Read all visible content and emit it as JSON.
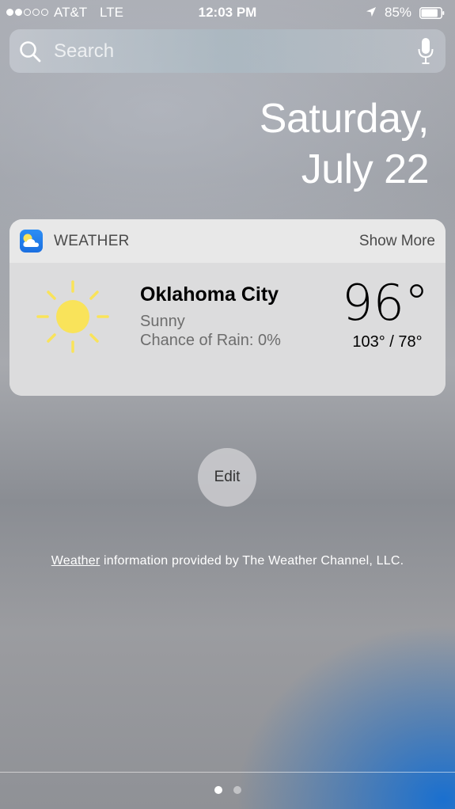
{
  "status_bar": {
    "carrier": "AT&T",
    "network": "LTE",
    "time": "12:03 PM",
    "battery": "85%",
    "battery_level": 0.85,
    "signal_bars": 2,
    "signal_total": 5
  },
  "search": {
    "placeholder": "Search"
  },
  "date": {
    "line1": "Saturday,",
    "line2": "July 22"
  },
  "weather_widget": {
    "title": "WEATHER",
    "show_more": "Show More",
    "city": "Oklahoma City",
    "condition": "Sunny",
    "rain": "Chance of Rain: 0%",
    "temperature": "96°",
    "high_low": "103° / 78°",
    "icon": "sun-icon",
    "app_icon": "weather-app-icon"
  },
  "edit_button": {
    "label": "Edit"
  },
  "attribution": {
    "link": "Weather",
    "text": " information provided by The Weather Channel, LLC."
  },
  "page_indicator": {
    "pages": 2,
    "current": 1
  },
  "colors": {
    "sun": "#f9e35a",
    "app_icon_blue": "#2c8ef5",
    "accent_blue": "#1b6fe0"
  }
}
